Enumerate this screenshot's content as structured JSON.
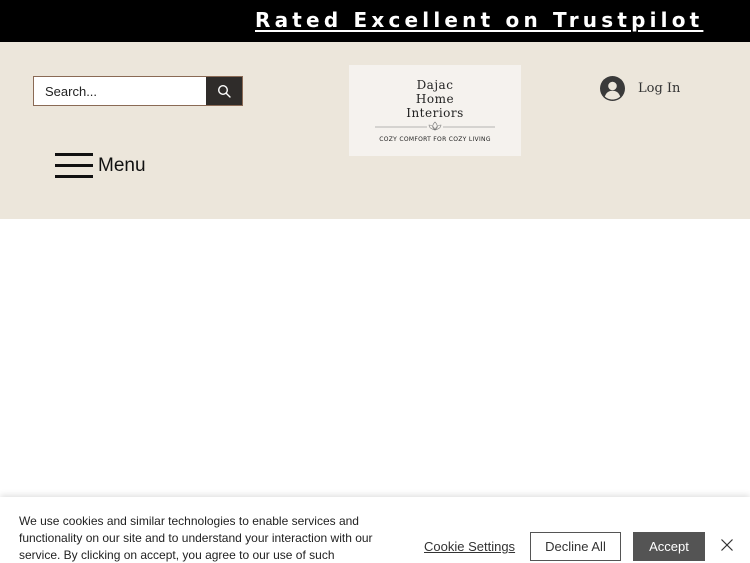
{
  "announcement": {
    "text": "Rated Excellent on Trustpilot"
  },
  "header": {
    "search": {
      "placeholder": "Search..."
    },
    "logo": {
      "line1": "Dajac",
      "line2": "Home",
      "line3": "Interiors",
      "tagline": "COZY COMFORT FOR COZY LIVING"
    },
    "login": {
      "label": "Log In"
    },
    "menu": {
      "label": "Menu"
    }
  },
  "cookie_banner": {
    "text": "We use cookies and similar technologies to enable services and functionality on our site and to understand your interaction with our service. By clicking on accept, you agree to our use of such",
    "settings_label": "Cookie Settings",
    "decline_label": "Decline All",
    "accept_label": "Accept"
  },
  "colors": {
    "announcement_bg": "#000000",
    "header_bg": "#ece6db",
    "search_button_bg": "#2f2c2a",
    "accept_bg": "#545454"
  },
  "icons": {
    "search": "search-icon",
    "user": "user-avatar-icon",
    "menu": "hamburger-icon",
    "close": "close-icon",
    "logo_ornament": "lotus-ornament-icon"
  }
}
